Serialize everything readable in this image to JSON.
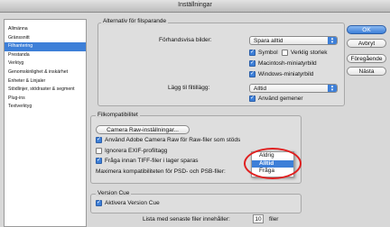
{
  "window": {
    "title": "Inställningar"
  },
  "sidebar": {
    "items": [
      {
        "label": "Allmänna",
        "selected": false
      },
      {
        "label": "Gränssnitt",
        "selected": false
      },
      {
        "label": "Filhantering",
        "selected": true
      },
      {
        "label": "Prestanda",
        "selected": false
      },
      {
        "label": "Verktyg",
        "selected": false
      },
      {
        "label": "Genomskinlighet & inskärhet",
        "selected": false
      },
      {
        "label": "Enheter & Linjaler",
        "selected": false
      },
      {
        "label": "Stödlinjer, stödraster & segment",
        "selected": false
      },
      {
        "label": "Plug-ins",
        "selected": false
      },
      {
        "label": "Textverktyg",
        "selected": false
      }
    ]
  },
  "save_options": {
    "group_title": "Alternativ för filsparande",
    "preview_label": "Förhandsvisa bilder:",
    "preview_value": "Spara alltid",
    "symbol": {
      "label": "Symbol",
      "checked": true
    },
    "real_size": {
      "label": "Verklig storlek",
      "checked": false
    },
    "mac_thumb": {
      "label": "Macintosh-miniatyrbild",
      "checked": true
    },
    "win_thumb": {
      "label": "Windows-miniatyrbild",
      "checked": true
    },
    "ext_label": "Lägg til filtillägg:",
    "ext_value": "Alltid",
    "lowercase": {
      "label": "Använd gemener",
      "checked": true
    }
  },
  "compat": {
    "group_title": "Filkompatibilitet",
    "camera_raw_button": "Camera Raw-inställningar...",
    "use_acr": {
      "label": "Använd Adobe Camera Raw för Raw-filer som stöds",
      "checked": true
    },
    "ignore_exif": {
      "label": "Ignorera EXIF-profiltagg",
      "checked": false
    },
    "ask_tiff": {
      "label": "Fråga innan TIFF-filer i lager sparas",
      "checked": true
    },
    "maximize_label": "Maximera kompatibiliteten för PSD- och PSB-filer:",
    "maximize_menu": {
      "options": [
        {
          "label": "Aldrig",
          "highlighted": false
        },
        {
          "label": "Alltid",
          "highlighted": true
        },
        {
          "label": "Fråga",
          "highlighted": false
        }
      ]
    }
  },
  "version_cue": {
    "group_title": "Version Cue",
    "activate": {
      "label": "Aktivera Version Cue",
      "checked": true
    }
  },
  "recent": {
    "label_before": "Lista med senaste filer innehåller:",
    "value": "10",
    "label_after": "filer"
  },
  "buttons": {
    "ok": "OK",
    "cancel": "Avbryt",
    "prev": "Föregående",
    "next": "Nästa"
  },
  "colors": {
    "accent": "#3d7fd8",
    "highlight_ring": "#e02020"
  }
}
